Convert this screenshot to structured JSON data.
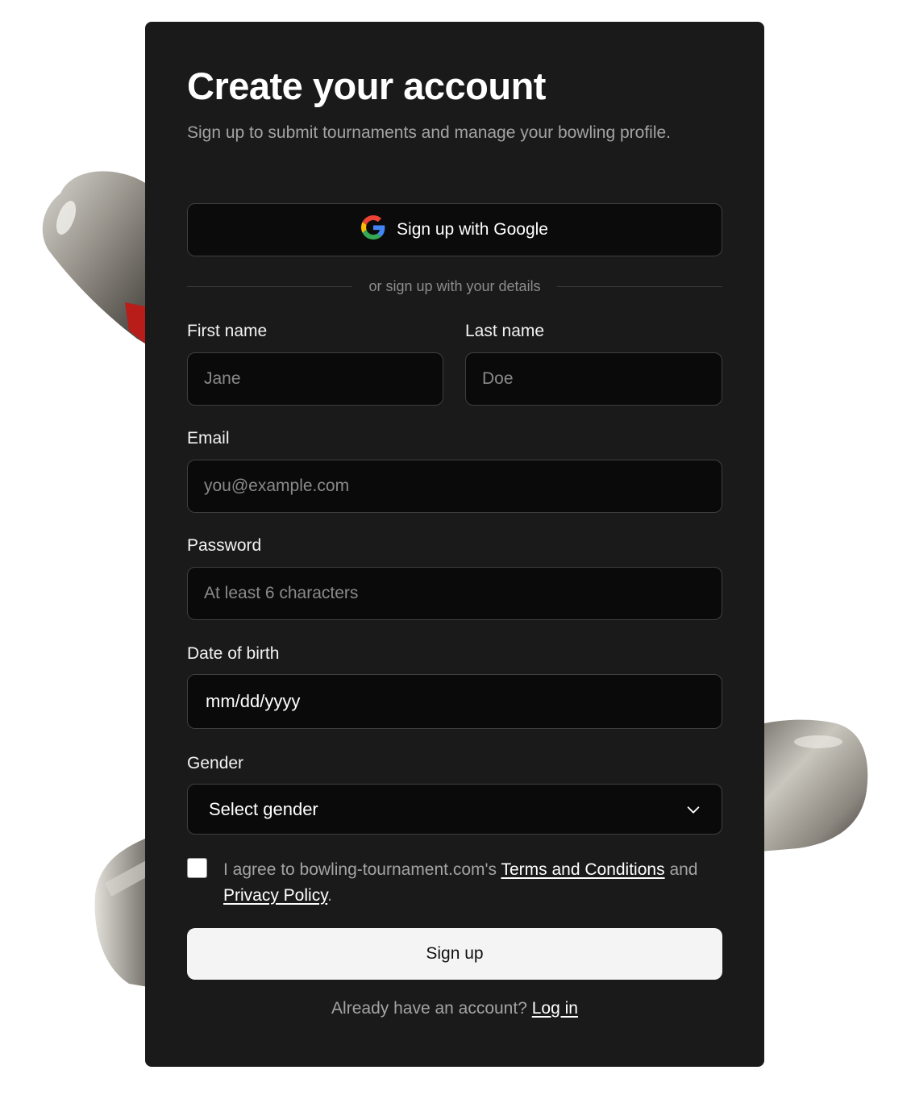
{
  "header": {
    "title": "Create your account",
    "subtitle": "Sign up to submit tournaments and manage your bowling profile."
  },
  "google": {
    "label": "Sign up with Google",
    "icon": "google-g-icon"
  },
  "divider": {
    "text": "or sign up with your details"
  },
  "form": {
    "first_name": {
      "label": "First name",
      "placeholder": "Jane"
    },
    "last_name": {
      "label": "Last name",
      "placeholder": "Doe"
    },
    "email": {
      "label": "Email",
      "placeholder": "you@example.com"
    },
    "password": {
      "label": "Password",
      "placeholder": "At least 6 characters"
    },
    "dob": {
      "label": "Date of birth",
      "value": "mm/dd/yyyy"
    },
    "gender": {
      "label": "Gender",
      "value": "Select gender",
      "icon": "chevron-down-icon"
    }
  },
  "agreement": {
    "checked": false,
    "prefix": "I agree to bowling-tournament.com's",
    "terms_link": "Terms and Conditions",
    "and": "and",
    "privacy_link": "Privacy Policy",
    "suffix": "."
  },
  "actions": {
    "signup_label": "Sign up"
  },
  "footer": {
    "prompt": "Already have an account?",
    "login_link": "Log in"
  },
  "colors": {
    "card_bg": "#1a1a1a",
    "field_bg": "#0a0a0a",
    "field_border": "#3f3f3f",
    "muted_text": "#a3a3a3",
    "primary_button_bg": "#f4f4f4"
  }
}
